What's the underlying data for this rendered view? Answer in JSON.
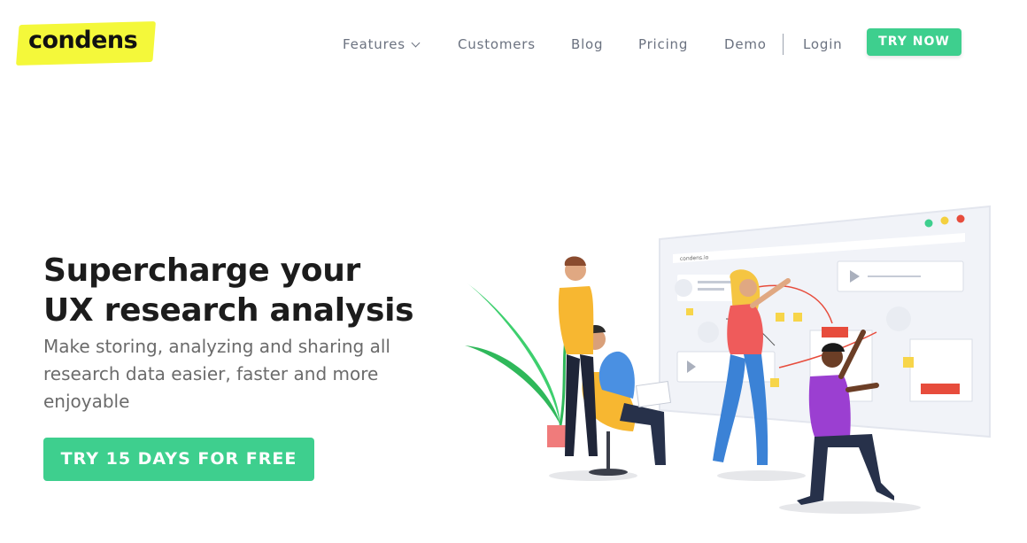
{
  "brand": {
    "logo_text": "condens",
    "accent": "#3ecf8e",
    "logo_highlight": "#f4f83a"
  },
  "nav": {
    "items": [
      {
        "label": "Features",
        "has_dropdown": true
      },
      {
        "label": "Customers"
      },
      {
        "label": "Blog"
      },
      {
        "label": "Pricing"
      },
      {
        "label": "Demo"
      }
    ],
    "login_label": "Login",
    "try_now_label": "TRY NOW"
  },
  "hero": {
    "title_line1": "Supercharge your",
    "title_line2": "UX research analysis",
    "subtitle": "Make storing, analyzing and sharing all research data easier, faster and more enjoyable",
    "cta_label": "TRY 15 DAYS FOR FREE"
  },
  "illustration": {
    "browser_url": "condens.io",
    "icon": "team-collaborating-on-board-illustration"
  }
}
